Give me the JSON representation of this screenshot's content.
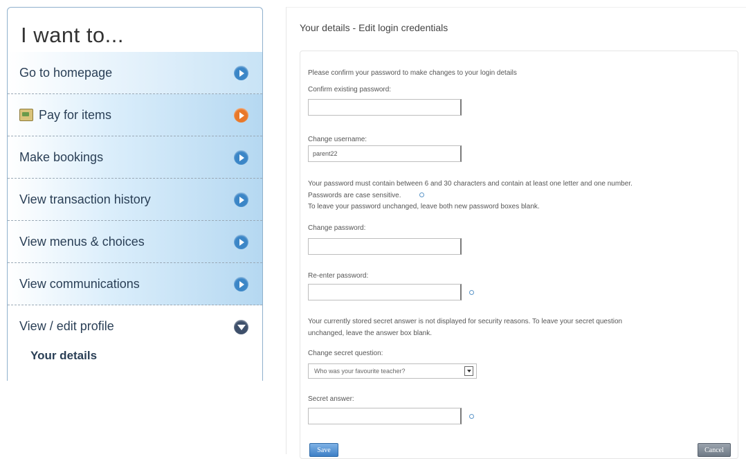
{
  "sidebar": {
    "title": "I want to...",
    "items": [
      {
        "label": "Go to homepage",
        "arrow": "right"
      },
      {
        "label": "Pay for items",
        "arrow": "right",
        "icon": "payment-icon"
      },
      {
        "label": "Make bookings",
        "arrow": "right"
      },
      {
        "label": "View transaction history",
        "arrow": "right"
      },
      {
        "label": "View menus & choices",
        "arrow": "right"
      },
      {
        "label": "View communications",
        "arrow": "right"
      },
      {
        "label": "View / edit profile",
        "arrow": "down"
      }
    ],
    "subitems": [
      "Your details"
    ]
  },
  "main": {
    "title": "Your details - Edit login credentials",
    "form": {
      "confirm_intro": "Please confirm your password to make changes to your login details",
      "confirm_label": "Confirm existing password:",
      "confirm_value": "",
      "username_label": "Change username:",
      "username_value": "parent22",
      "password_rules_1": "Your password must contain between 6 and 30 characters and contain at least one letter and one number.",
      "password_rules_2": "Passwords are case sensitive.",
      "password_rules_3": "To leave your password unchanged, leave both new password boxes blank.",
      "change_password_label": "Change password:",
      "reenter_password_label": "Re-enter password:",
      "secret_note_1": "Your currently stored secret answer is not displayed for security reasons. To leave your secret question",
      "secret_note_2": "unchanged, leave the answer box blank.",
      "secret_question_label": "Change secret question:",
      "secret_question_value": "Who was your favourite teacher?",
      "secret_answer_label": "Secret answer:",
      "save_label": "Save",
      "cancel_label": "Cancel"
    }
  },
  "colors": {
    "accent": "#3b86c7",
    "pay_arrow": "#e8782a",
    "expanded_arrow": "#3d4f6a",
    "nav_text": "#2a3f56"
  }
}
